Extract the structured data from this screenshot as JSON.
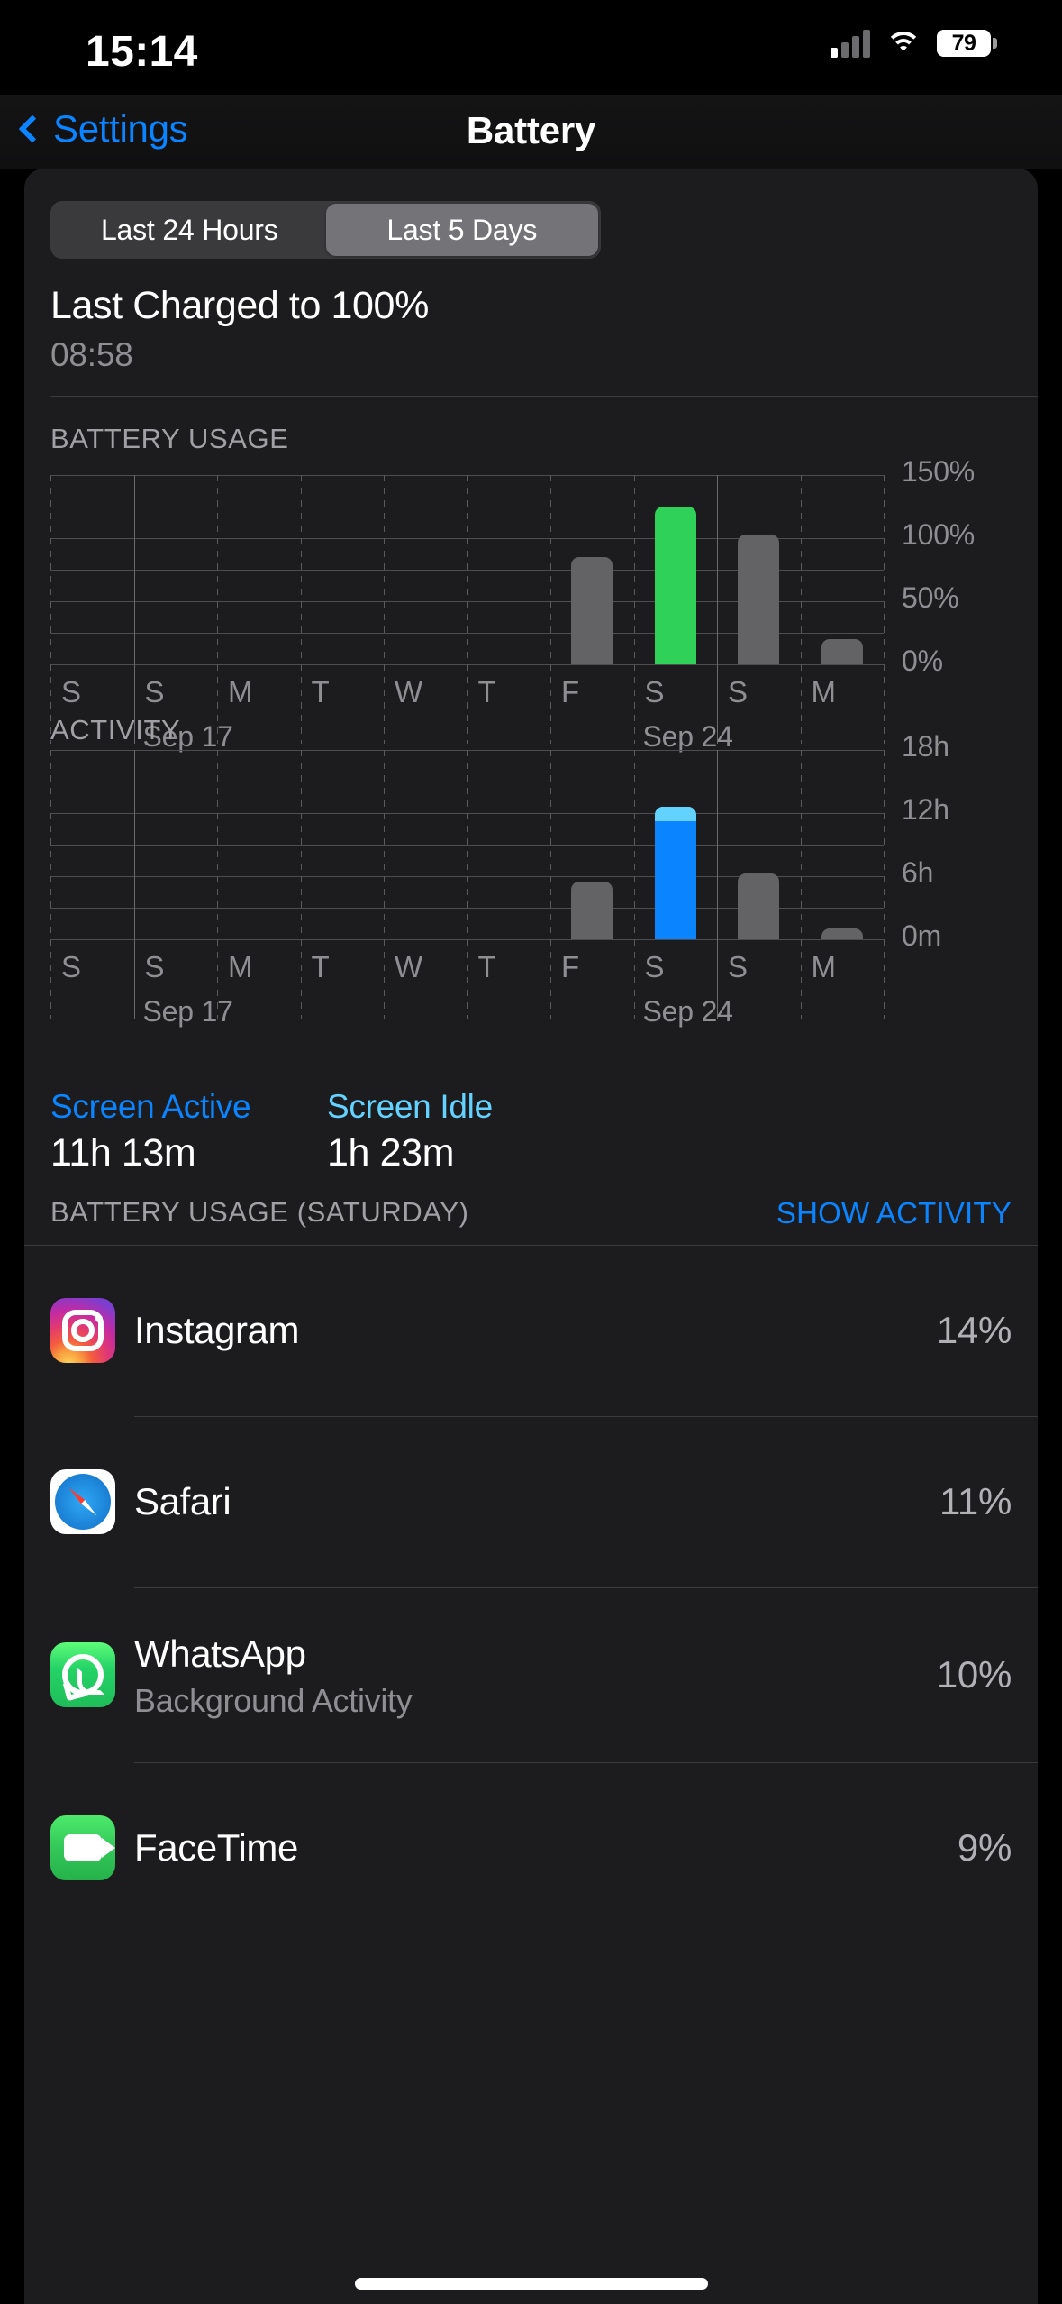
{
  "status_bar": {
    "time": "15:14",
    "battery_percent": "79",
    "signal_icon": "cellular-signal-icon",
    "wifi_icon": "wifi-icon",
    "battery_icon": "battery-icon"
  },
  "nav": {
    "back_label": "Settings",
    "back_icon": "chevron-left-icon",
    "title": "Battery"
  },
  "segmented": {
    "options": [
      {
        "label": "Last 24 Hours",
        "selected": false
      },
      {
        "label": "Last 5 Days",
        "selected": true
      }
    ]
  },
  "last_charged": {
    "title": "Last Charged to 100%",
    "time": "08:58"
  },
  "sections": {
    "battery_usage_header": "BATTERY USAGE",
    "activity_header": "ACTIVITY",
    "app_list_header": "BATTERY USAGE (SATURDAY)",
    "show_activity_link": "SHOW ACTIVITY"
  },
  "screen_stats": {
    "active_label": "Screen Active",
    "active_value": "11h 13m",
    "active_color": "#0a84ff",
    "idle_label": "Screen Idle",
    "idle_value": "1h 23m",
    "idle_color": "#64d2ff"
  },
  "apps": [
    {
      "name": "Instagram",
      "subtitle": "",
      "percent": "14%",
      "icon": "instagram-icon"
    },
    {
      "name": "Safari",
      "subtitle": "",
      "percent": "11%",
      "icon": "safari-icon"
    },
    {
      "name": "WhatsApp",
      "subtitle": "Background Activity",
      "percent": "10%",
      "icon": "whatsapp-icon"
    },
    {
      "name": "FaceTime",
      "subtitle": "",
      "percent": "9%",
      "icon": "facetime-icon"
    }
  ],
  "chart_data": [
    {
      "type": "bar",
      "title": "BATTERY USAGE",
      "xlabel": "",
      "ylabel": "",
      "categories": [
        "S",
        "S",
        "M",
        "T",
        "W",
        "T",
        "F",
        "S",
        "S",
        "M"
      ],
      "date_labels": [
        {
          "index": 1,
          "text": "Sep 17"
        },
        {
          "index": 7,
          "text": "Sep 24"
        }
      ],
      "values": [
        0,
        0,
        0,
        0,
        0,
        0,
        85,
        125,
        103,
        20
      ],
      "highlight_index": 7,
      "highlight_color": "#30d158",
      "bar_color": "#636366",
      "ytick_labels": [
        "150%",
        "100%",
        "50%",
        "0%"
      ],
      "ytick_values": [
        150,
        100,
        50,
        0
      ],
      "ylim": [
        0,
        150
      ],
      "gridlines_every": 25,
      "grid": true
    },
    {
      "type": "bar",
      "title": "ACTIVITY",
      "xlabel": "",
      "ylabel": "",
      "categories": [
        "S",
        "S",
        "M",
        "T",
        "W",
        "T",
        "F",
        "S",
        "S",
        "M"
      ],
      "date_labels": [
        {
          "index": 1,
          "text": "Sep 17"
        },
        {
          "index": 7,
          "text": "Sep 24"
        }
      ],
      "series": [
        {
          "name": "Screen Active",
          "color": "#0a84ff",
          "values": [
            0,
            0,
            0,
            0,
            0,
            0,
            5.5,
            11.22,
            6.3,
            1.0
          ]
        },
        {
          "name": "Screen Idle",
          "color": "#64d2ff",
          "values": [
            0,
            0,
            0,
            0,
            0,
            0,
            0,
            1.38,
            0,
            0
          ]
        }
      ],
      "values": [
        0,
        0,
        0,
        0,
        0,
        0,
        5.5,
        12.6,
        6.3,
        1.0
      ],
      "highlight_index": 7,
      "bar_color": "#636366",
      "ytick_labels": [
        "18h",
        "12h",
        "6h",
        "0m"
      ],
      "ytick_values": [
        18,
        12,
        6,
        0
      ],
      "ylim": [
        0,
        18
      ],
      "gridlines_every": 3,
      "grid": true
    }
  ]
}
